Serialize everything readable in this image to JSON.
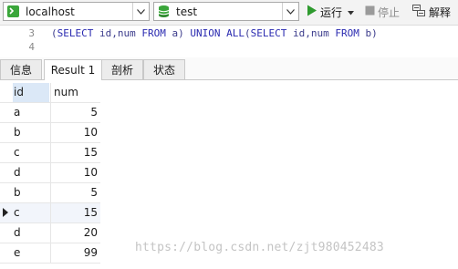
{
  "toolbar": {
    "connection": {
      "value": "localhost",
      "icon": "connection-icon"
    },
    "database": {
      "value": "test",
      "icon": "database-icon"
    },
    "run_label": "运行",
    "stop_label": "停止",
    "explain_label": "解释"
  },
  "editor": {
    "lines": [
      {
        "number": "3",
        "code": "(SELECT id,num FROM a) UNION ALL(SELECT id,num FROM b)"
      },
      {
        "number": "4",
        "code": ""
      }
    ]
  },
  "tabs": [
    {
      "label": "信息",
      "active": false
    },
    {
      "label": "Result 1",
      "active": true
    },
    {
      "label": "剖析",
      "active": false
    },
    {
      "label": "状态",
      "active": false
    }
  ],
  "grid": {
    "columns": [
      "id",
      "num"
    ],
    "rows": [
      {
        "id": "a",
        "num": "5"
      },
      {
        "id": "b",
        "num": "10"
      },
      {
        "id": "c",
        "num": "15"
      },
      {
        "id": "d",
        "num": "10"
      },
      {
        "id": "b",
        "num": "5"
      },
      {
        "id": "c",
        "num": "15"
      },
      {
        "id": "d",
        "num": "20"
      },
      {
        "id": "e",
        "num": "99"
      }
    ],
    "selected_row": 5
  },
  "watermark": "https://blog.csdn.net/zjt980452483",
  "colors": {
    "accent_green": "#2e9a2e",
    "selected_header": "#dbe8f7"
  }
}
